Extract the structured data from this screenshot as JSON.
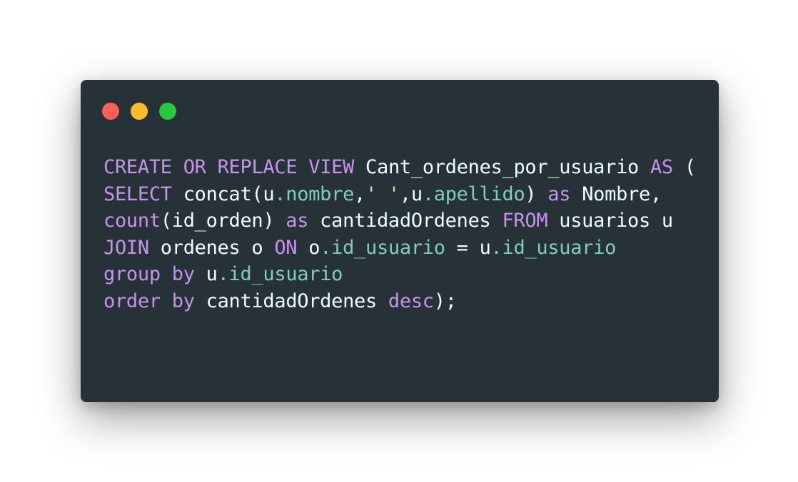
{
  "window": {
    "background": "#263238",
    "controls": [
      {
        "name": "close-icon",
        "color": "#ff5f56"
      },
      {
        "name": "minimize-icon",
        "color": "#ffbd2e"
      },
      {
        "name": "maximize-icon",
        "color": "#27c93f"
      }
    ]
  },
  "theme": {
    "keyword": "#c792ea",
    "property": "#80cbc4",
    "string": "#c3e88d",
    "text": "#eeffff"
  },
  "code": {
    "language": "sql",
    "lines": [
      [
        {
          "t": "CREATE",
          "k": "keyword"
        },
        {
          "t": " ",
          "k": "text"
        },
        {
          "t": "OR",
          "k": "keyword"
        },
        {
          "t": " ",
          "k": "text"
        },
        {
          "t": "REPLACE",
          "k": "keyword"
        },
        {
          "t": " ",
          "k": "text"
        },
        {
          "t": "VIEW",
          "k": "keyword"
        },
        {
          "t": " Cant_ordenes_por_usuario ",
          "k": "text"
        },
        {
          "t": "AS",
          "k": "keyword"
        },
        {
          "t": " (",
          "k": "text"
        }
      ],
      [
        {
          "t": "SELECT",
          "k": "keyword"
        },
        {
          "t": " concat(u",
          "k": "text"
        },
        {
          "t": ".nombre",
          "k": "property"
        },
        {
          "t": ",",
          "k": "text"
        },
        {
          "t": "' '",
          "k": "string"
        },
        {
          "t": ",u",
          "k": "text"
        },
        {
          "t": ".apellido",
          "k": "property"
        },
        {
          "t": ") ",
          "k": "text"
        },
        {
          "t": "as",
          "k": "keyword"
        },
        {
          "t": " Nombre,",
          "k": "text"
        }
      ],
      [
        {
          "t": "count",
          "k": "keyword"
        },
        {
          "t": "(id_orden) ",
          "k": "text"
        },
        {
          "t": "as",
          "k": "keyword"
        },
        {
          "t": " cantidadOrdenes ",
          "k": "text"
        },
        {
          "t": "FROM",
          "k": "keyword"
        },
        {
          "t": " usuarios u",
          "k": "text"
        }
      ],
      [
        {
          "t": "JOIN",
          "k": "keyword"
        },
        {
          "t": " ordenes o ",
          "k": "text"
        },
        {
          "t": "ON",
          "k": "keyword"
        },
        {
          "t": " o",
          "k": "text"
        },
        {
          "t": ".id_usuario",
          "k": "property"
        },
        {
          "t": " = u",
          "k": "text"
        },
        {
          "t": ".id_usuario",
          "k": "property"
        }
      ],
      [
        {
          "t": "group",
          "k": "keyword"
        },
        {
          "t": " ",
          "k": "text"
        },
        {
          "t": "by",
          "k": "keyword"
        },
        {
          "t": " u",
          "k": "text"
        },
        {
          "t": ".id_usuario",
          "k": "property"
        }
      ],
      [
        {
          "t": "order",
          "k": "keyword"
        },
        {
          "t": " ",
          "k": "text"
        },
        {
          "t": "by",
          "k": "keyword"
        },
        {
          "t": " cantidadOrdenes ",
          "k": "text"
        },
        {
          "t": "desc",
          "k": "keyword"
        },
        {
          "t": ");",
          "k": "text"
        }
      ]
    ]
  }
}
